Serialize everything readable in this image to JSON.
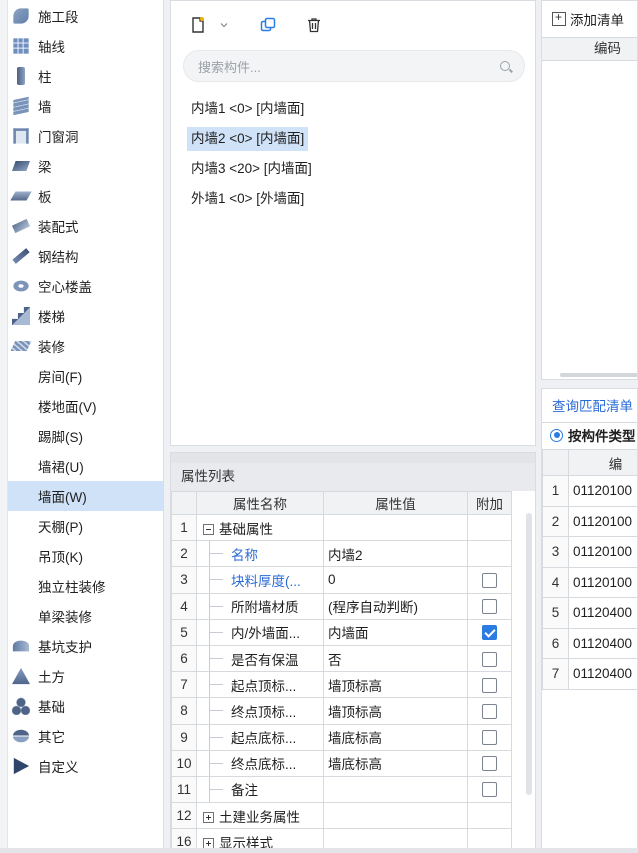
{
  "nav": {
    "items": [
      {
        "label": "施工段",
        "icon": "construction-segment-icon",
        "cls": "i-seg"
      },
      {
        "label": "轴线",
        "icon": "axis-grid-icon",
        "cls": "i-grid"
      },
      {
        "label": "柱",
        "icon": "column-icon",
        "cls": "i-col"
      },
      {
        "label": "墙",
        "icon": "wall-icon",
        "cls": "i-wall"
      },
      {
        "label": "门窗洞",
        "icon": "door-window-opening-icon",
        "cls": "i-door"
      },
      {
        "label": "梁",
        "icon": "beam-icon",
        "cls": "i-beam"
      },
      {
        "label": "板",
        "icon": "slab-icon",
        "cls": "i-slab"
      },
      {
        "label": "装配式",
        "icon": "prefab-icon",
        "cls": "i-prefab"
      },
      {
        "label": "钢结构",
        "icon": "steel-structure-icon",
        "cls": "i-steel"
      },
      {
        "label": "空心楼盖",
        "icon": "hollow-floor-icon",
        "cls": "i-hollow"
      },
      {
        "label": "楼梯",
        "icon": "stair-icon",
        "cls": "i-stair"
      },
      {
        "label": "装修",
        "icon": "decoration-icon",
        "cls": "i-deco"
      },
      {
        "label": "房间(F)",
        "sub": true
      },
      {
        "label": "楼地面(V)",
        "sub": true
      },
      {
        "label": "踢脚(S)",
        "sub": true
      },
      {
        "label": "墙裙(U)",
        "sub": true
      },
      {
        "label": "墙面(W)",
        "sub": true,
        "selected": true
      },
      {
        "label": "天棚(P)",
        "sub": true
      },
      {
        "label": "吊顶(K)",
        "sub": true
      },
      {
        "label": "独立柱装修",
        "sub": true
      },
      {
        "label": "单梁装修",
        "sub": true
      },
      {
        "label": "基坑支护",
        "icon": "pit-support-icon",
        "cls": "i-pit"
      },
      {
        "label": "土方",
        "icon": "earthwork-icon",
        "cls": "i-earth"
      },
      {
        "label": "基础",
        "icon": "foundation-icon",
        "cls": "i-found"
      },
      {
        "label": "其它",
        "icon": "other-icon",
        "cls": "i-other"
      },
      {
        "label": "自定义",
        "icon": "custom-icon",
        "cls": "i-custom"
      }
    ]
  },
  "components": {
    "search_placeholder": "搜索构件...",
    "items": [
      {
        "label": "内墙1 <0> [内墙面]"
      },
      {
        "label": "内墙2 <0> [内墙面]",
        "selected": true
      },
      {
        "label": "内墙3 <20> [内墙面]"
      },
      {
        "label": "外墙1 <0> [外墙面]"
      }
    ]
  },
  "attributes": {
    "title": "属性列表",
    "col_name": "属性名称",
    "col_value": "属性值",
    "col_extra": "附加",
    "rows": [
      {
        "n": "1",
        "name": "基础属性",
        "value": "",
        "expander": "minus",
        "checkbox": null
      },
      {
        "n": "2",
        "name": "名称",
        "value": "内墙2",
        "blue": true,
        "checkbox": null
      },
      {
        "n": "3",
        "name": "块料厚度(...",
        "value": "0",
        "blue": true,
        "checkbox": false
      },
      {
        "n": "4",
        "name": "所附墙材质",
        "value": "(程序自动判断)",
        "checkbox": false
      },
      {
        "n": "5",
        "name": "内/外墙面...",
        "value": "内墙面",
        "checkbox": true
      },
      {
        "n": "6",
        "name": "是否有保温",
        "value": "否",
        "checkbox": false
      },
      {
        "n": "7",
        "name": "起点顶标...",
        "value": "墙顶标高",
        "checkbox": false
      },
      {
        "n": "8",
        "name": "终点顶标...",
        "value": "墙顶标高",
        "checkbox": false
      },
      {
        "n": "9",
        "name": "起点底标...",
        "value": "墙底标高",
        "checkbox": false
      },
      {
        "n": "10",
        "name": "终点底标...",
        "value": "墙底标高",
        "checkbox": false
      },
      {
        "n": "11",
        "name": "备注",
        "value": "",
        "checkbox": false
      },
      {
        "n": "12",
        "name": "土建业务属性",
        "value": "",
        "expander": "plus",
        "checkbox": null
      },
      {
        "n": "16",
        "name": "显示样式",
        "value": "",
        "expander": "plus",
        "checkbox": null
      }
    ]
  },
  "list_panel": {
    "add_label": "添加清单",
    "col_code": "编码"
  },
  "match_panel": {
    "tab_label": "查询匹配清单",
    "radio_label": "按构件类型",
    "col_code": "编",
    "rows": [
      {
        "n": "1",
        "code": "01120100"
      },
      {
        "n": "2",
        "code": "01120100"
      },
      {
        "n": "3",
        "code": "01120100"
      },
      {
        "n": "4",
        "code": "01120100"
      },
      {
        "n": "5",
        "code": "01120400"
      },
      {
        "n": "6",
        "code": "01120400"
      },
      {
        "n": "7",
        "code": "01120400"
      }
    ]
  }
}
